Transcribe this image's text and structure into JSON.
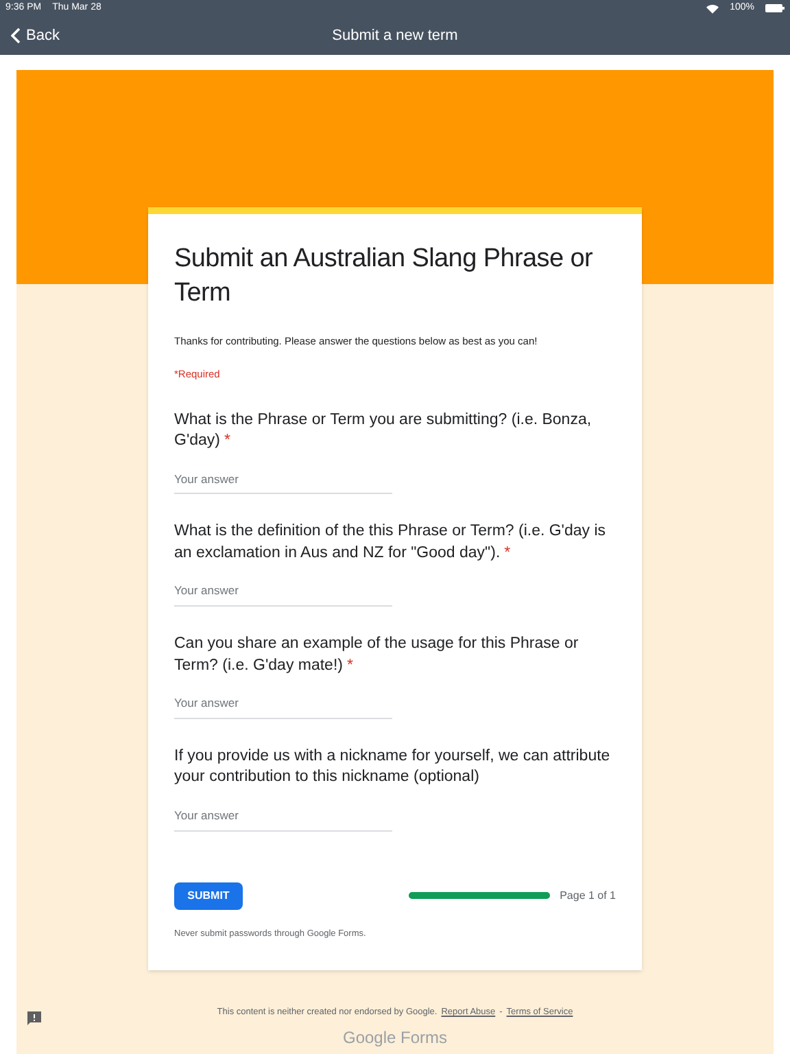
{
  "status_bar": {
    "time": "9:36 PM",
    "date": "Thu Mar 28",
    "battery": "100%"
  },
  "nav": {
    "back": "Back",
    "title": "Submit a new term"
  },
  "form": {
    "title": "Submit an Australian Slang Phrase or Term",
    "description": "Thanks for contributing. Please answer the questions below as best as you can!",
    "required_note": "*Required",
    "questions": [
      {
        "label": "What is the Phrase or Term you are submitting? (i.e. Bonza, G'day)",
        "required_mark": "*",
        "placeholder": "Your answer"
      },
      {
        "label": "What is the definition of the this Phrase or Term? (i.e. G'day is an exclamation in Aus and NZ for \"Good day\").",
        "required_mark": "*",
        "placeholder": "Your answer"
      },
      {
        "label": "Can you share an example of the usage for this Phrase or Term? (i.e. G'day mate!)",
        "required_mark": "*",
        "placeholder": "Your answer"
      },
      {
        "label": "If you provide us with a nickname for yourself, we can attribute your contribution to this nickname (optional)",
        "placeholder": "Your answer"
      }
    ],
    "submit": "SUBMIT",
    "progress": {
      "level": 1,
      "label": "Page 1 of 1"
    },
    "warning": "Never submit passwords through Google Forms."
  },
  "footer": {
    "text": "This content is neither created nor endorsed by Google.",
    "links": [
      "Report Abuse",
      "Terms of Service"
    ],
    "separator": "-",
    "brand": "Google Forms"
  }
}
